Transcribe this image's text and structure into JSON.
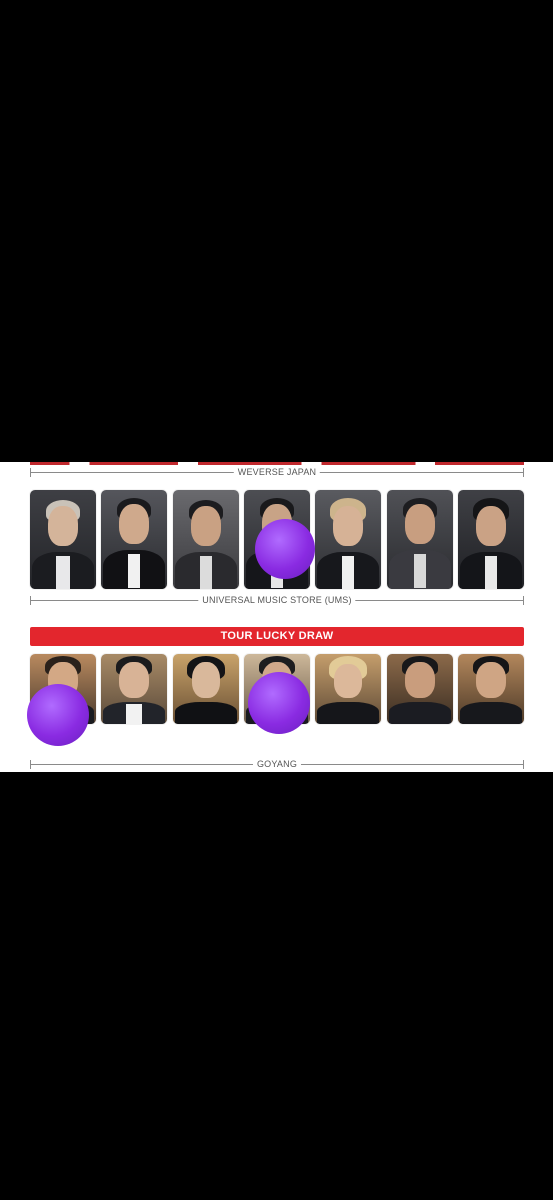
{
  "sections": {
    "weverse_japan": "WEVERSE JAPAN",
    "ums": "UNIVERSAL MUSIC STORE (UMS)",
    "tour_lucky_draw": "TOUR LUCKY DRAW",
    "goyang": "GOYANG"
  },
  "row1": {
    "cards": [
      {
        "member": "photocard-1",
        "blurred": false
      },
      {
        "member": "photocard-2",
        "blurred": false
      },
      {
        "member": "photocard-3",
        "blurred": false
      },
      {
        "member": "photocard-4",
        "blurred": true
      },
      {
        "member": "photocard-5",
        "blurred": false
      },
      {
        "member": "photocard-6",
        "blurred": false
      },
      {
        "member": "photocard-7",
        "blurred": false
      }
    ]
  },
  "row2": {
    "cards": [
      {
        "member": "photocard-1",
        "blurred": true
      },
      {
        "member": "photocard-2",
        "blurred": false
      },
      {
        "member": "photocard-3",
        "blurred": false
      },
      {
        "member": "photocard-4",
        "blurred": true
      },
      {
        "member": "photocard-5",
        "blurred": false
      },
      {
        "member": "photocard-6",
        "blurred": false
      },
      {
        "member": "photocard-7",
        "blurred": false
      }
    ]
  },
  "colors": {
    "background": "#000000",
    "panel": "#ffffff",
    "banner": "#e3262d",
    "blur_sticker": "#8a2be2"
  }
}
